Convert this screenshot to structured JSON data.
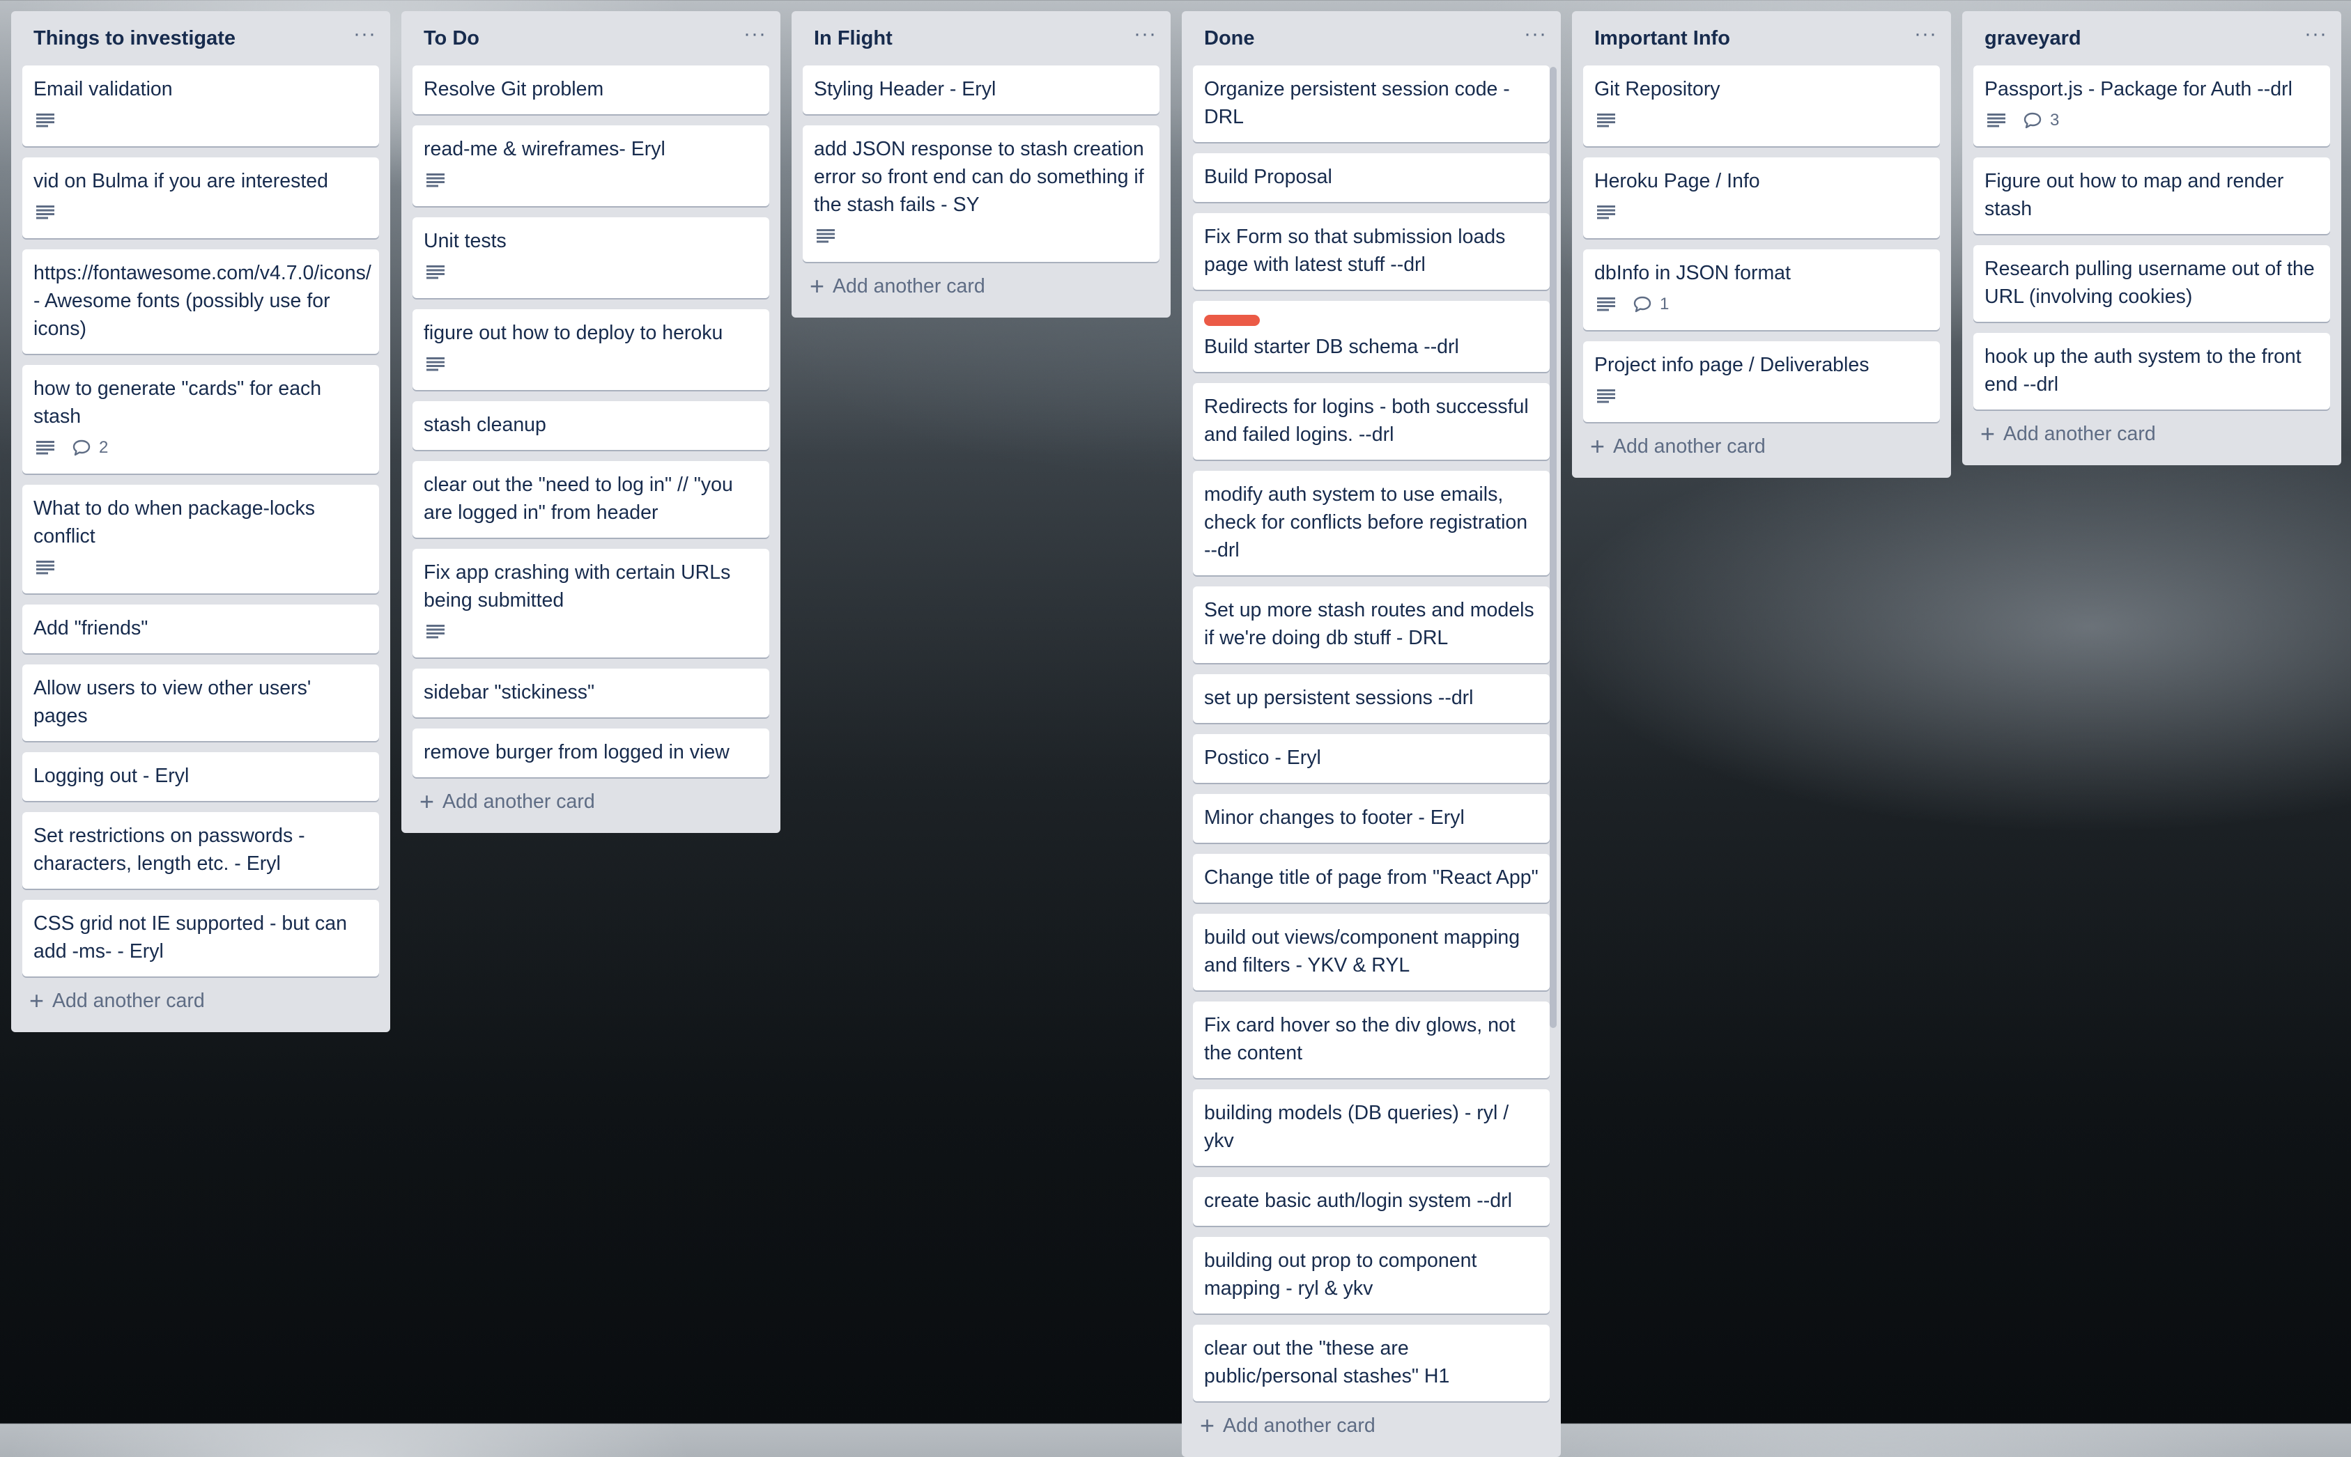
{
  "lists": [
    {
      "title": "Things to investigate",
      "add_label": "Add another card",
      "cards": [
        {
          "text": "Email validation",
          "desc": true
        },
        {
          "text": "vid on Bulma if you are interested",
          "desc": true
        },
        {
          "text": "https://fontawesome.com/v4.7.0/icons/ - Awesome fonts (possibly use for icons)"
        },
        {
          "text": "how to generate \"cards\" for each stash",
          "desc": true,
          "comments": "2"
        },
        {
          "text": "What to do when package-locks conflict",
          "desc": true
        },
        {
          "text": "Add \"friends\""
        },
        {
          "text": "Allow users to view other users' pages"
        },
        {
          "text": "Logging out - Eryl"
        },
        {
          "text": "Set restrictions on passwords - characters, length etc. - Eryl"
        },
        {
          "text": "CSS grid not IE supported - but can add -ms- - Eryl"
        }
      ]
    },
    {
      "title": "To Do",
      "add_label": "Add another card",
      "cards": [
        {
          "text": "Resolve Git problem"
        },
        {
          "text": "read-me & wireframes- Eryl",
          "desc": true
        },
        {
          "text": "Unit tests",
          "desc": true
        },
        {
          "text": "figure out how to deploy to heroku",
          "desc": true
        },
        {
          "text": "stash cleanup"
        },
        {
          "text": "clear out the \"need to log in\" // \"you are logged in\" from header"
        },
        {
          "text": "Fix app crashing with certain URLs being submitted",
          "desc": true
        },
        {
          "text": "sidebar \"stickiness\""
        },
        {
          "text": "remove burger from logged in view"
        }
      ]
    },
    {
      "title": "In Flight",
      "add_label": "Add another card",
      "cards": [
        {
          "text": "Styling Header - Eryl"
        },
        {
          "text": "add JSON response to stash creation error so front end can do something if the stash fails - SY",
          "desc": true
        }
      ]
    },
    {
      "title": "Done",
      "add_label": "Add another card",
      "scroll": true,
      "cards": [
        {
          "text": "Organize persistent session code - DRL"
        },
        {
          "text": "Build Proposal"
        },
        {
          "text": "Fix Form so that submission loads page with latest stuff --drl"
        },
        {
          "text": "Build starter DB schema --drl",
          "label_color": "#eb5a46"
        },
        {
          "text": "Redirects for logins - both successful and failed logins. --drl"
        },
        {
          "text": "modify auth system to use emails, check for conflicts before registration --drl"
        },
        {
          "text": "Set up more stash routes and models if we're doing db stuff - DRL"
        },
        {
          "text": "set up persistent sessions --drl"
        },
        {
          "text": "Postico - Eryl"
        },
        {
          "text": "Minor changes to footer - Eryl"
        },
        {
          "text": "Change title of page from \"React App\""
        },
        {
          "text": "build out views/component mapping and filters - YKV & RYL"
        },
        {
          "text": "Fix card hover so the div glows, not the content"
        },
        {
          "text": "building models (DB queries) - ryl / ykv"
        },
        {
          "text": "create basic auth/login system --drl"
        },
        {
          "text": "building out prop to component mapping - ryl & ykv"
        },
        {
          "text": "clear out the \"these are public/personal stashes\" H1"
        }
      ]
    },
    {
      "title": "Important Info",
      "add_label": "Add another card",
      "cards": [
        {
          "text": "Git Repository",
          "desc": true
        },
        {
          "text": "Heroku Page / Info",
          "desc": true
        },
        {
          "text": "dbInfo in JSON format",
          "desc": true,
          "comments": "1"
        },
        {
          "text": "Project info page / Deliverables",
          "desc": true
        }
      ]
    },
    {
      "title": "graveyard",
      "add_label": "Add another card",
      "cards": [
        {
          "text": "Passport.js - Package for Auth --drl",
          "desc": true,
          "comments": "3"
        },
        {
          "text": "Figure out how to map and render stash"
        },
        {
          "text": "Research pulling username out of the URL (involving cookies)"
        },
        {
          "text": "hook up the auth system to the front end --drl"
        }
      ]
    }
  ]
}
